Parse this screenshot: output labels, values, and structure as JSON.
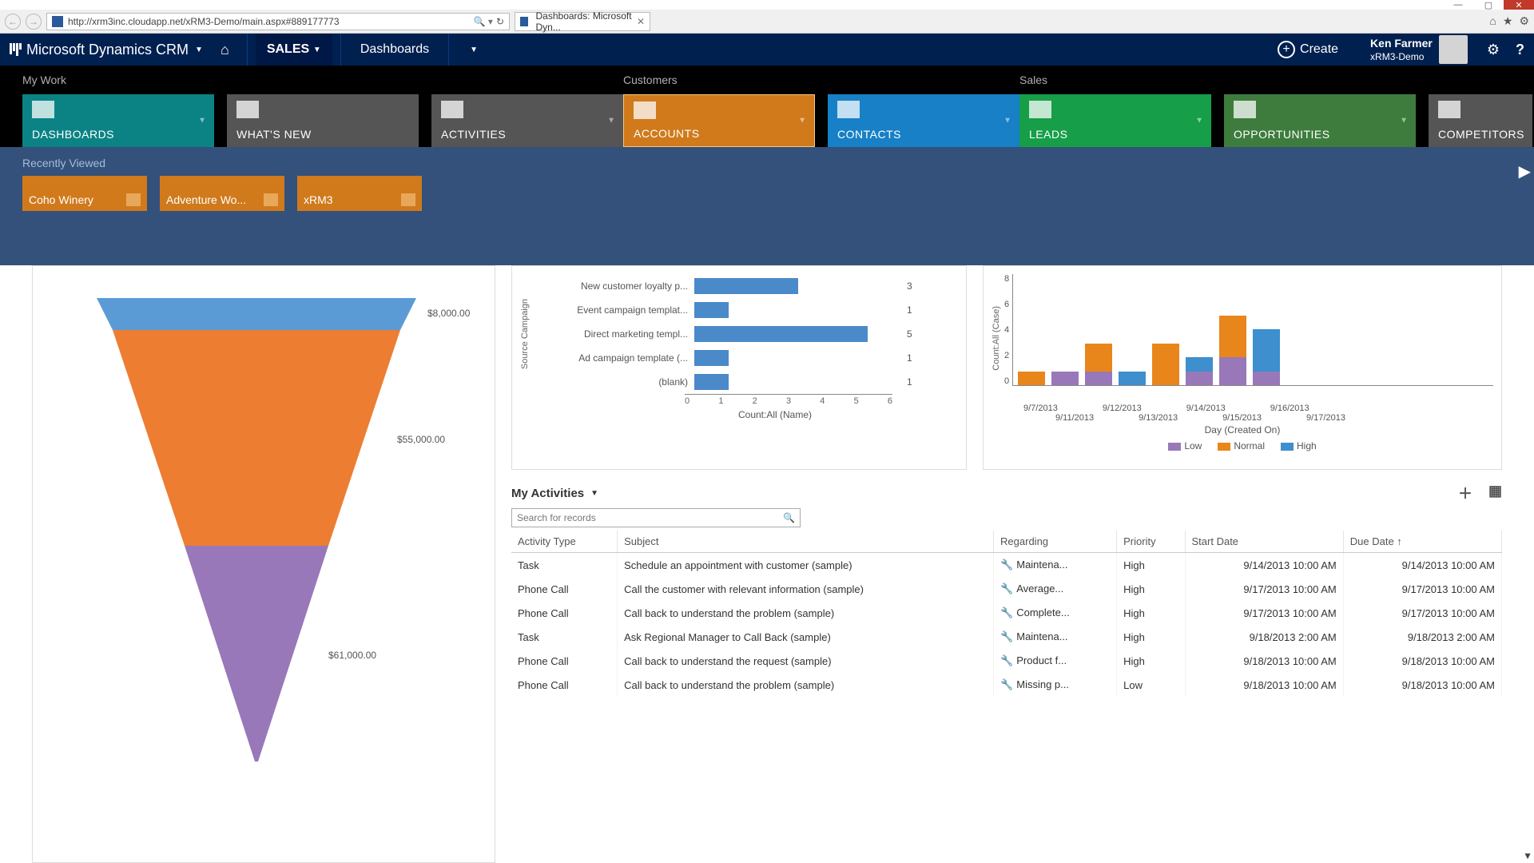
{
  "window": {
    "minimize": "—",
    "maximize": "▢",
    "close": "✕"
  },
  "browser": {
    "url": "http://xrm3inc.cloudapp.net/xRM3-Demo/main.aspx#889177773",
    "tab_title": "Dashboards: Microsoft Dyn...",
    "tab_close": "✕"
  },
  "topnav": {
    "product": "Microsoft Dynamics CRM",
    "sales": "SALES",
    "dashboards": "Dashboards",
    "create": "Create",
    "user_name": "Ken Farmer",
    "org": "xRM3-Demo"
  },
  "sitemap": {
    "groups": {
      "mywork": {
        "label": "My Work",
        "tiles": [
          "DASHBOARDS",
          "WHAT'S NEW",
          "ACTIVITIES"
        ]
      },
      "customers": {
        "label": "Customers",
        "tiles": [
          "ACCOUNTS",
          "CONTACTS"
        ]
      },
      "sales": {
        "label": "Sales",
        "tiles": [
          "LEADS",
          "OPPORTUNITIES",
          "COMPETITORS"
        ]
      }
    },
    "recent_label": "Recently Viewed",
    "recent": [
      "Coho Winery",
      "Adventure Wo...",
      "xRM3"
    ]
  },
  "funnel": {
    "labels": [
      "$8,000.00",
      "$55,000.00",
      "$61,000.00"
    ]
  },
  "activities": {
    "title": "My Activities",
    "search_placeholder": "Search for records",
    "columns": [
      "Activity Type",
      "Subject",
      "Regarding",
      "Priority",
      "Start Date",
      "Due Date ↑"
    ],
    "rows": [
      {
        "type": "Task",
        "subject": "Schedule an appointment with customer (sample)",
        "regarding": "Maintena...",
        "priority": "High",
        "start": "9/14/2013 10:00 AM",
        "due": "9/14/2013 10:00 AM"
      },
      {
        "type": "Phone Call",
        "subject": "Call the customer with relevant information (sample)",
        "regarding": "Average...",
        "priority": "High",
        "start": "9/17/2013 10:00 AM",
        "due": "9/17/2013 10:00 AM"
      },
      {
        "type": "Phone Call",
        "subject": "Call back to understand the problem (sample)",
        "regarding": "Complete...",
        "priority": "High",
        "start": "9/17/2013 10:00 AM",
        "due": "9/17/2013 10:00 AM"
      },
      {
        "type": "Task",
        "subject": "Ask Regional Manager to Call Back (sample)",
        "regarding": "Maintena...",
        "priority": "High",
        "start": "9/18/2013 2:00 AM",
        "due": "9/18/2013 2:00 AM"
      },
      {
        "type": "Phone Call",
        "subject": "Call back to understand the request (sample)",
        "regarding": "Product f...",
        "priority": "High",
        "start": "9/18/2013 10:00 AM",
        "due": "9/18/2013 10:00 AM"
      },
      {
        "type": "Phone Call",
        "subject": "Call back to understand the problem (sample)",
        "regarding": "Missing p...",
        "priority": "Low",
        "start": "9/18/2013 10:00 AM",
        "due": "9/18/2013 10:00 AM"
      }
    ]
  },
  "chart_data": [
    {
      "type": "funnel",
      "series": [
        {
          "label": "$8,000.00",
          "value": 8000,
          "color": "#5b9bd5"
        },
        {
          "label": "$55,000.00",
          "value": 55000,
          "color": "#ed7d31"
        },
        {
          "label": "$61,000.00",
          "value": 61000,
          "color": "#9878b8"
        }
      ]
    },
    {
      "type": "bar",
      "orientation": "horizontal",
      "ylabel": "Source Campaign",
      "xlabel": "Count:All (Name)",
      "xlim": [
        0,
        6
      ],
      "xticks": [
        0,
        1,
        2,
        3,
        4,
        5,
        6
      ],
      "categories": [
        "New customer loyalty p...",
        "Event campaign templat...",
        "Direct marketing templ...",
        "Ad campaign template (...",
        "(blank)"
      ],
      "values": [
        3,
        1,
        5,
        1,
        1
      ]
    },
    {
      "type": "bar",
      "stacked": true,
      "ylabel": "Count:All (Case)",
      "xlabel": "Day (Created On)",
      "ylim": [
        0,
        8
      ],
      "yticks": [
        0,
        2,
        4,
        6,
        8
      ],
      "categories": [
        "9/7/2013",
        "9/11/2013",
        "9/12/2013",
        "9/13/2013",
        "9/14/2013",
        "9/15/2013",
        "9/16/2013",
        "9/17/2013"
      ],
      "series": [
        {
          "name": "Low",
          "color": "#9878b8",
          "values": [
            0,
            1,
            1,
            0,
            0,
            1,
            2,
            1
          ]
        },
        {
          "name": "Normal",
          "color": "#e8861c",
          "values": [
            1,
            0,
            2,
            0,
            3,
            0,
            3,
            0
          ]
        },
        {
          "name": "High",
          "color": "#3d8fce",
          "values": [
            0,
            0,
            0,
            1,
            0,
            1,
            0,
            3
          ]
        }
      ],
      "legend": [
        "Low",
        "Normal",
        "High"
      ]
    }
  ]
}
